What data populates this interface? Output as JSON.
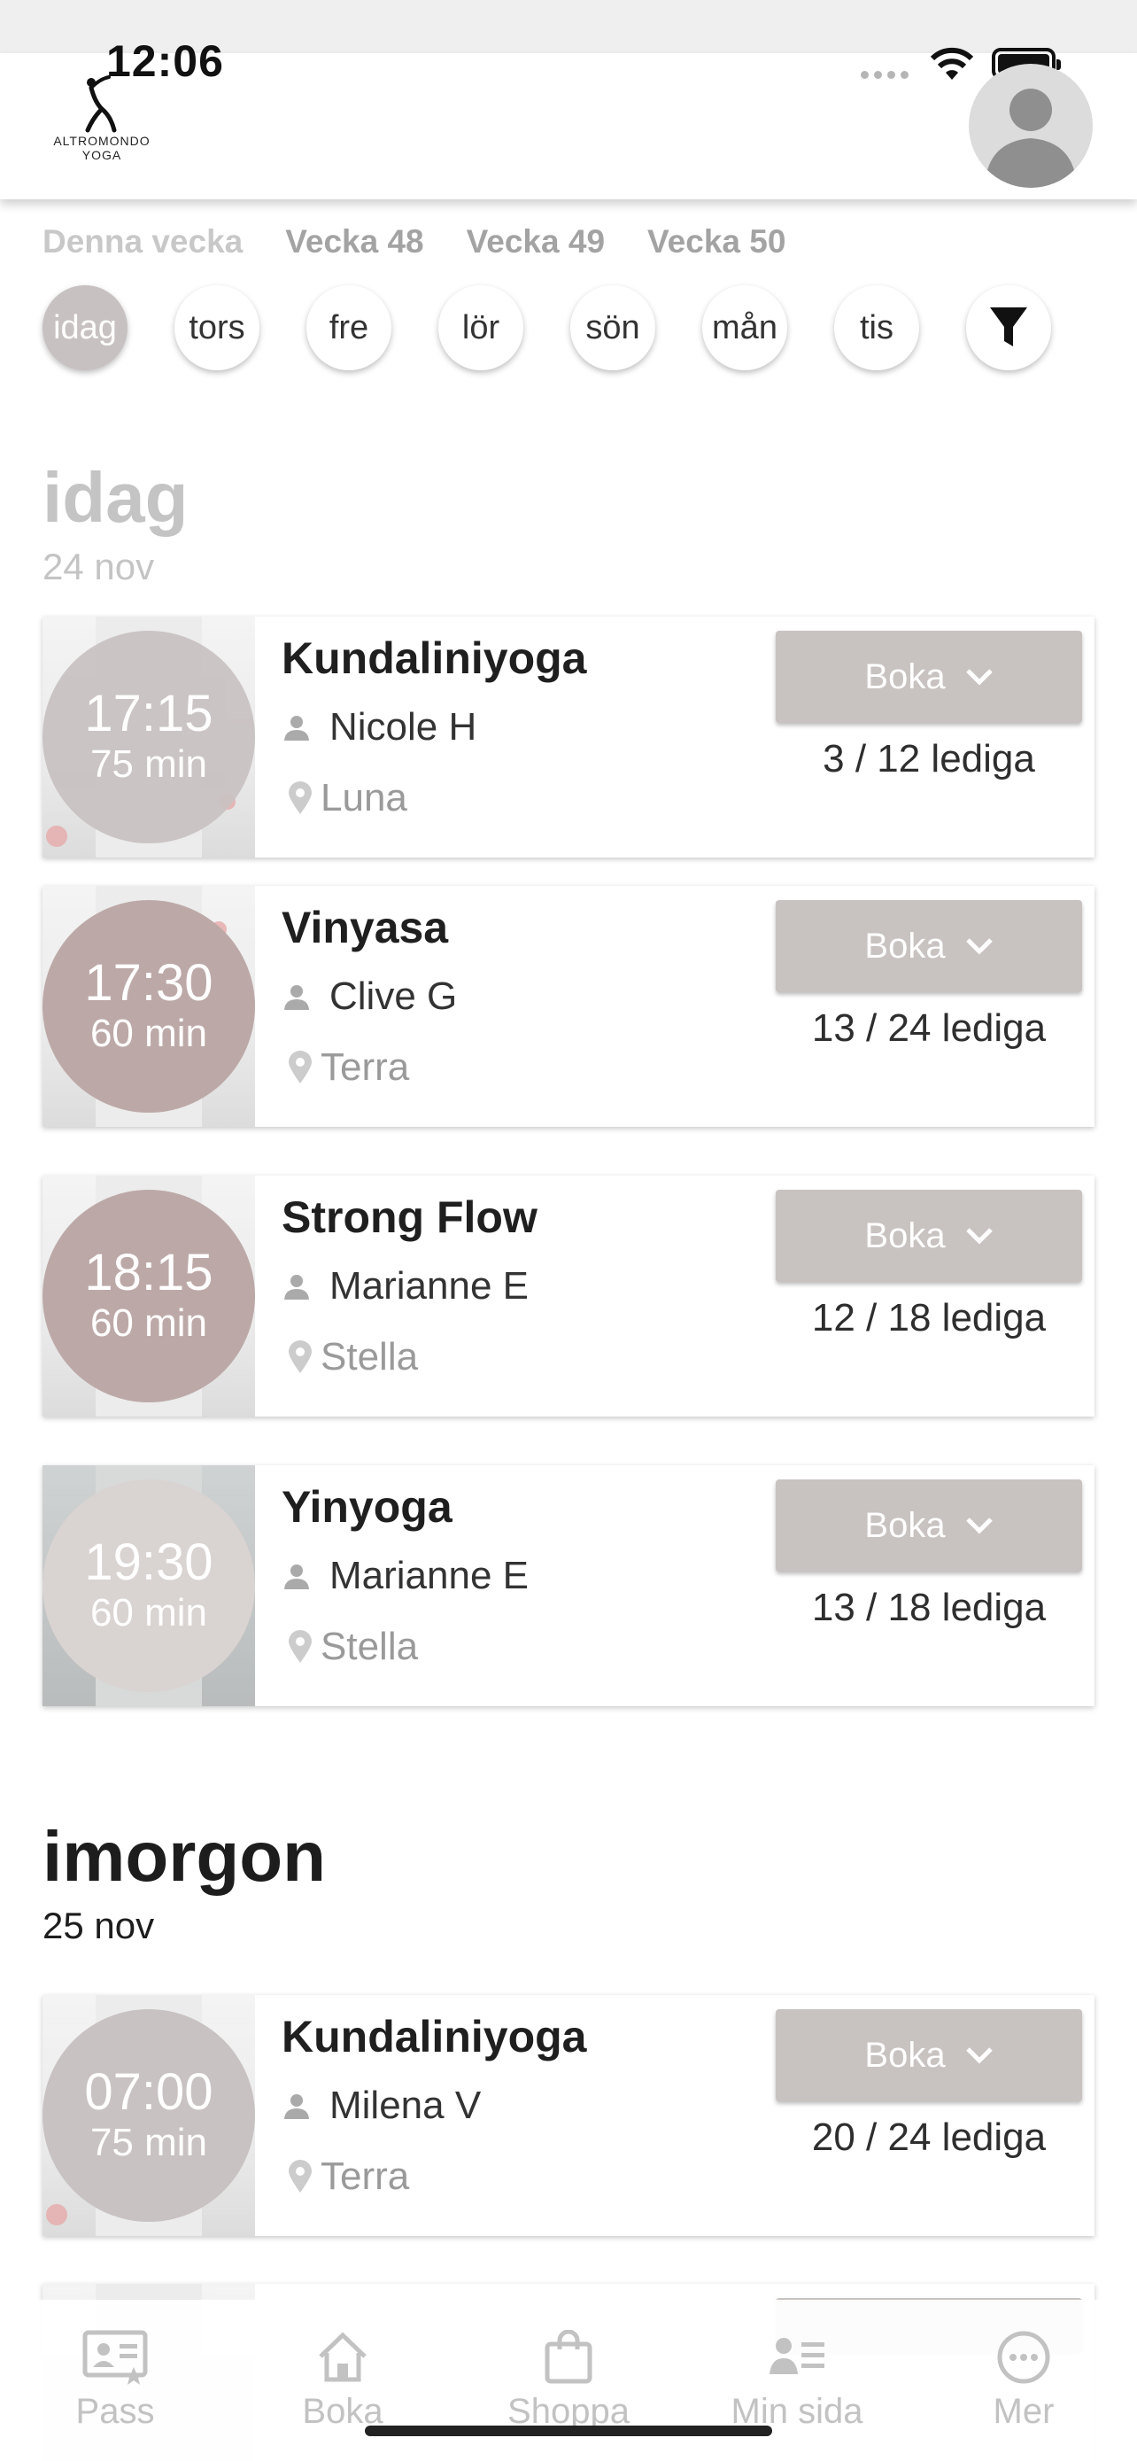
{
  "status_bar": {
    "time": "12:06"
  },
  "header": {
    "logo_line1": "ALTROMONDO",
    "logo_line2": "YOGA"
  },
  "week_tabs": [
    "Denna vecka",
    "Vecka 48",
    "Vecka 49",
    "Vecka 50"
  ],
  "day_filters": [
    "idag",
    "tors",
    "fre",
    "lör",
    "sön",
    "mån",
    "tis"
  ],
  "today": {
    "title": "idag",
    "date": "24 nov",
    "classes": [
      {
        "time": "17:15",
        "duration": "75 min",
        "name": "Kundaliniyoga",
        "instructor": "Nicole H",
        "room": "Luna",
        "book_label": "Boka",
        "spots": "3 / 12 lediga"
      },
      {
        "time": "17:30",
        "duration": "60 min",
        "name": "Vinyasa",
        "instructor": "Clive G",
        "room": "Terra",
        "book_label": "Boka",
        "spots": "13 / 24 lediga"
      },
      {
        "time": "18:15",
        "duration": "60 min",
        "name": "Strong Flow",
        "instructor": "Marianne E",
        "room": "Stella",
        "book_label": "Boka",
        "spots": "12 / 18 lediga"
      },
      {
        "time": "19:30",
        "duration": "60 min",
        "name": "Yinyoga",
        "instructor": "Marianne E",
        "room": "Stella",
        "book_label": "Boka",
        "spots": "13 / 18 lediga"
      }
    ]
  },
  "tomorrow": {
    "title": "imorgon",
    "date": "25 nov",
    "classes": [
      {
        "time": "07:00",
        "duration": "75 min",
        "name": "Kundaliniyoga",
        "instructor": "Milena V",
        "room": "Terra",
        "book_label": "Boka",
        "spots": "20 / 24 lediga"
      }
    ]
  },
  "tab_bar": [
    "Pass",
    "Boka",
    "Shoppa",
    "Min sida",
    "Mer"
  ],
  "colors": {
    "muted_title": "#c4c4c4",
    "button_bg": "#c8c2c0",
    "circle_a": "#c9c2c2",
    "circle_b": "#bca9a7",
    "circle_c": "#d9d3d1"
  }
}
